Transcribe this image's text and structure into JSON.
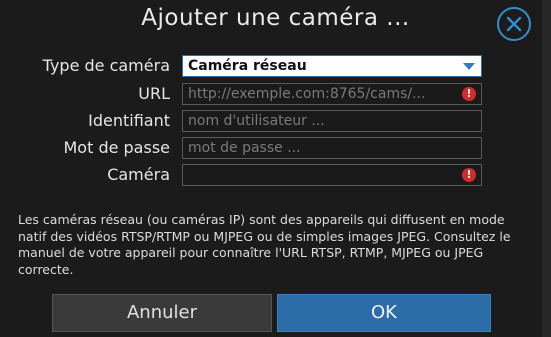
{
  "dialog": {
    "title": "Ajouter une caméra ...",
    "close_icon": "close-icon",
    "accent_color": "#2f8fce"
  },
  "form": {
    "camera_type": {
      "label": "Type de caméra",
      "selected_value": "Caméra réseau"
    },
    "url": {
      "label": "URL",
      "placeholder": "http://exemple.com:8765/cams/..."
    },
    "username": {
      "label": "Identifiant",
      "placeholder": "nom d'utilisateur ..."
    },
    "password": {
      "label": "Mot de passe",
      "placeholder": "mot de passe ..."
    },
    "camera": {
      "label": "Caméra",
      "value": ""
    },
    "error_glyph": "!"
  },
  "description": "Les caméras réseau (ou caméras IP) sont des appareils qui diffusent en mode natif des vidéos RTSP/RTMP ou MJPEG ou de simples images JPEG. Consultez le manuel de votre appareil pour connaître l'URL RTSP, RTMP, MJPEG ou JPEG correcte.",
  "buttons": {
    "cancel_label": "Annuler",
    "ok_label": "OK"
  }
}
